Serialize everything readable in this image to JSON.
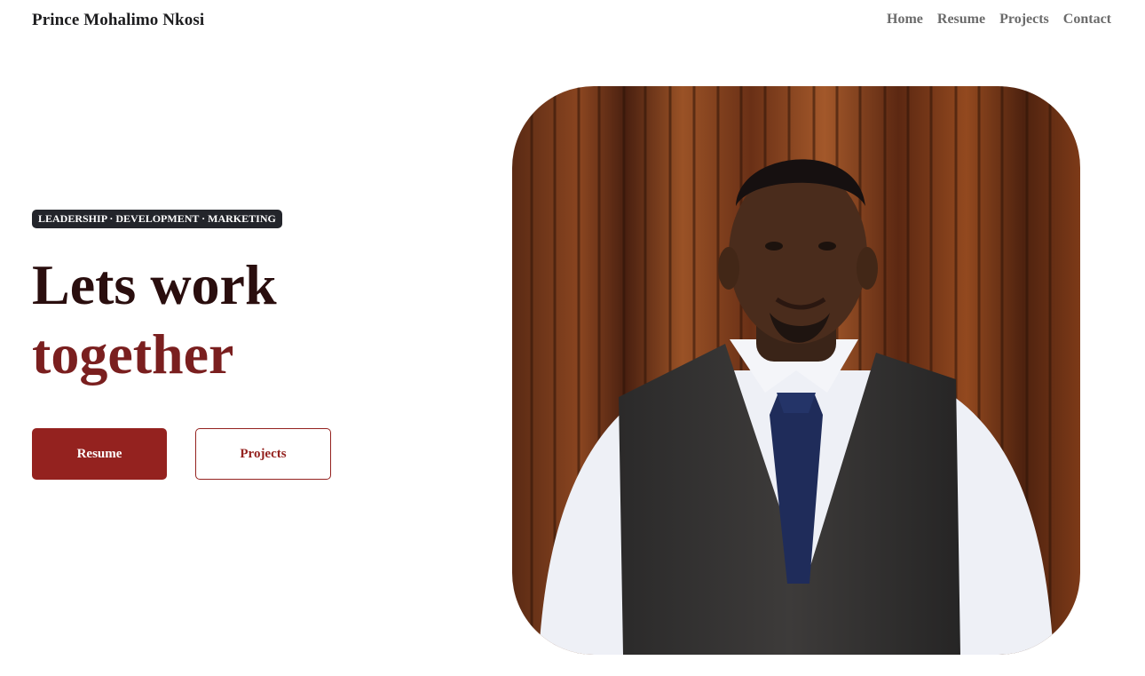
{
  "brand": {
    "name": "Prince Mohalimo Nkosi"
  },
  "nav": {
    "home": "Home",
    "resume": "Resume",
    "projects": "Projects",
    "contact": "Contact"
  },
  "hero": {
    "badge": "LEADERSHIP · DEVELOPMENT · MARKETING",
    "headline_line1": "Lets work",
    "headline_line2": "together",
    "primary_button": "Resume",
    "secondary_button": "Projects"
  },
  "colors": {
    "accent": "#94221f",
    "headline_dark": "#2a0e0e",
    "headline_red": "#7a1f1f",
    "badge_bg": "#23252b"
  }
}
